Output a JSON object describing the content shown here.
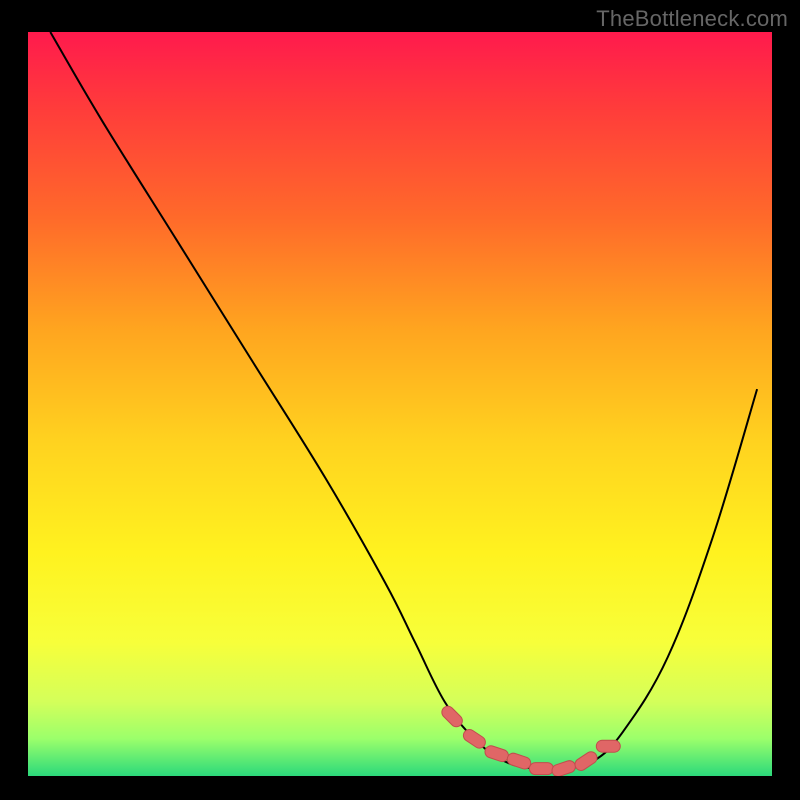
{
  "watermark": "TheBottleneck.com",
  "colors": {
    "frame_bg": "#000000",
    "watermark": "#666666",
    "curve": "#000000",
    "marker_fill": "#e06666",
    "marker_stroke": "#c14d4d",
    "gradient_stops": [
      {
        "offset": 0.0,
        "color": "#ff1a4d"
      },
      {
        "offset": 0.1,
        "color": "#ff3b3b"
      },
      {
        "offset": 0.25,
        "color": "#ff6a2a"
      },
      {
        "offset": 0.4,
        "color": "#ffa51f"
      },
      {
        "offset": 0.55,
        "color": "#ffd21f"
      },
      {
        "offset": 0.7,
        "color": "#fff21f"
      },
      {
        "offset": 0.82,
        "color": "#f7ff3a"
      },
      {
        "offset": 0.9,
        "color": "#d4ff5a"
      },
      {
        "offset": 0.95,
        "color": "#9bff6b"
      },
      {
        "offset": 1.0,
        "color": "#2bd97b"
      }
    ]
  },
  "chart_data": {
    "type": "line",
    "title": "",
    "xlabel": "",
    "ylabel": "",
    "xlim": [
      0,
      100
    ],
    "ylim": [
      0,
      100
    ],
    "legend": false,
    "grid": false,
    "series": [
      {
        "name": "bottleneck-curve",
        "x": [
          3,
          10,
          20,
          30,
          40,
          48,
          52,
          56,
          60,
          64,
          68,
          72,
          76,
          80,
          86,
          92,
          98
        ],
        "values": [
          100,
          88,
          72,
          56,
          40,
          26,
          18,
          10,
          5,
          2,
          1,
          1,
          2,
          6,
          16,
          32,
          52
        ]
      }
    ],
    "markers": {
      "name": "optimal-range",
      "x": [
        57,
        60,
        63,
        66,
        69,
        72,
        75,
        78
      ],
      "values": [
        8,
        5,
        3,
        2,
        1,
        1,
        2,
        4
      ]
    },
    "background": "vertical-gradient red→yellow→green (top→bottom)"
  }
}
